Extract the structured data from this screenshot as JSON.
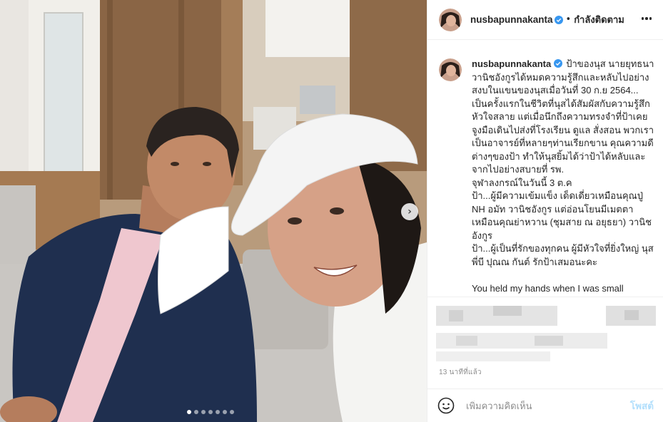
{
  "post": {
    "username": "nusbapunnakanta",
    "follow_status": "กำลังติดตาม",
    "separator": "•",
    "caption_text": "ป้าของนุส นายยุทธนา วานิชอังกูรได้หมดความรู้สึกและหลับไปอย่างสงบในแขนของนุสเมื่อวันที่ 30 ก.ย 2564... เป็นครั้งแรกในชีวิตที่นุสได้สัมผัสกับความรู้สึกหัวใจสลาย แต่เมื่อนึกถึงความทรงจำที่ป้าเคยจูงมือเดินไปส่งที่โรงเรียน ดูแล สั่งสอน พวกเรา เป็นอาจารย์ที่หลายๆท่านเรียกขาน คุณความดีต่างๆของป้า ทำให้นุสยิ้มได้ว่าป้าได้หลับและจากไปอย่างสบายที่ รพ.\nจุฬาลงกรณ์ในวันนี้ 3 ต.ค\nป้า...ผู้มีความเข้มแข็ง เด็ดเดี่ยวเหมือนคุณปู่ NH อมัท วานิชอังกูร แต่อ่อนโยนมีเมตตาเหมือนคุณย่าหวาน (ชุมสาย ณ อยุธยา) วานิชอังกูร\nป้า...ผู้เป็นที่รักของทุกคน ผู้มีหัวใจที่ยิ่งใหญ่ นุส พี่บี ปุณณ กันต์ รักป้าเสมอนะคะ\n\nYou held my hands when I was small\nYou caught me when I fell",
    "timestamp": "13 นาทีที่แล้ว",
    "comment_placeholder": "เพิ่มความคิดเห็น",
    "post_button": "โพสต์"
  },
  "carousel": {
    "total_slides": 7,
    "active_slide": 1,
    "next_glyph": "›"
  },
  "colors": {
    "verified": "#3897f0",
    "post_button_disabled": "#b2dffc",
    "muted_text": "#8e8e8e"
  },
  "icons": {
    "verified": "verified-badge-icon",
    "more": "more-options-icon",
    "emoji": "emoji-icon",
    "next": "chevron-right-icon"
  }
}
